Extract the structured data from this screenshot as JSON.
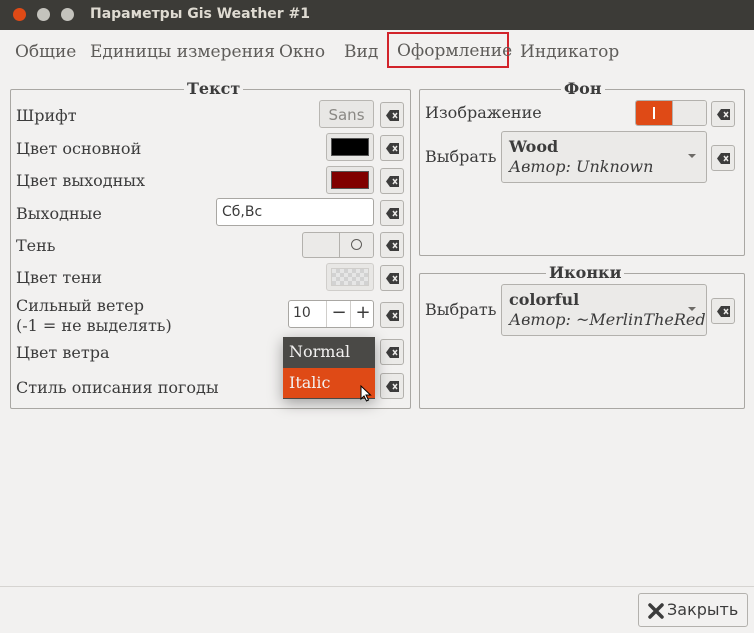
{
  "window": {
    "title": "Параметры Gis Weather #1"
  },
  "tabs": [
    {
      "label": "Общие"
    },
    {
      "label": "Единицы измерения"
    },
    {
      "label": "Окно"
    },
    {
      "label": "Вид"
    },
    {
      "label": "Оформление"
    },
    {
      "label": "Индикатор"
    }
  ],
  "text_frame": {
    "title": "Текст",
    "font_label": "Шрифт",
    "font_value": "Sans",
    "main_color_label": "Цвет основной",
    "main_color": "#000000",
    "weekend_color_label": "Цвет выходных",
    "weekend_color": "#800000",
    "weekend_label": "Выходные",
    "weekend_value": "Сб,Вс",
    "shadow_label": "Тень",
    "shadow_color_label": "Цвет тени",
    "strong_wind_label_1": "Сильный ветер",
    "strong_wind_label_2": "(-1 = не выделять)",
    "strong_wind_value": "10",
    "wind_color_label": "Цвет ветра",
    "weather_style_label": "Стиль описания погоды"
  },
  "style_popup": {
    "items": [
      "Normal",
      "Italic"
    ],
    "selected": "Italic"
  },
  "background_frame": {
    "title": "Фон",
    "image_label": "Изображение",
    "select_label": "Выбрать",
    "theme_name": "Wood",
    "theme_author": "Автор: Unknown"
  },
  "icons_frame": {
    "title": "Иконки",
    "select_label": "Выбрать",
    "theme_name": "colorful",
    "theme_author": "Автор: ~MerlinTheRed"
  },
  "footer": {
    "close_label": "Закрыть"
  },
  "colors": {
    "accent": "#df4a16",
    "titlebar": "#3c3b37",
    "active_tab_outline": "#d2232a"
  }
}
